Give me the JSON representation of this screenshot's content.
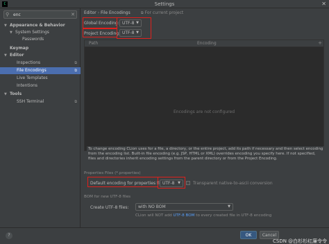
{
  "window": {
    "title": "Settings",
    "app_icon_text": "C"
  },
  "search": {
    "value": "enc"
  },
  "sidebar": {
    "items": [
      {
        "label": "Appearance & Behavior",
        "arrow": "▼"
      },
      {
        "label": "System Settings",
        "arrow": "▼"
      },
      {
        "label": "Passwords"
      },
      {
        "label": "Keymap"
      },
      {
        "label": "Editor",
        "arrow": "▼"
      },
      {
        "label": "Inspections",
        "project_icon": "⧉"
      },
      {
        "label": "File Encodings",
        "project_icon": "⧉"
      },
      {
        "label": "Live Templates"
      },
      {
        "label": "Intentions"
      },
      {
        "label": "Tools",
        "arrow": "▼"
      },
      {
        "label": "SSH Terminal",
        "project_icon": "⧉"
      }
    ]
  },
  "main": {
    "breadcrumb": {
      "parent": "Editor",
      "separator": "›",
      "current": "File Encodings"
    },
    "for_current_project": "For current project",
    "global_encoding": {
      "label": "Global Encoding:",
      "value": "UTF-8"
    },
    "project_encoding": {
      "label": "Project Encoding:",
      "value": "UTF-8"
    },
    "table": {
      "columns": [
        "Path",
        "Encoding"
      ],
      "empty_text": "Encodings are not configured"
    },
    "info_text": "To change encoding CLion uses for a file, a directory, or the entire project, add its path if necessary and then select encoding from the encoding list. Built-in file encoding (e.g. JSP, HTML or XML) overrides encoding you specify here. If not specified, files and directories inherit encoding settings from the parent directory or from the Project Encoding.",
    "properties": {
      "section_title": "Properties Files (*.properties)",
      "default_label": "Default encoding for properties files:",
      "default_value": "UTF-8",
      "transparent_label": "Transparent native-to-ascii conversion"
    },
    "bom": {
      "section_title": "BOM for new UTF-8 files",
      "create_label": "Create UTF-8 files:",
      "create_value": "with NO BOM",
      "note_before": "CLion will NOT add ",
      "note_link": "UTF-8 BOM",
      "note_after": " to every created file in UTF-8 encoding"
    }
  },
  "footer": {
    "help": "?",
    "ok_label": "OK",
    "cancel_label": "Cancel"
  },
  "watermark": "CSDN @白杉杉红廉令令",
  "colors": {
    "selection": "#4b6eaf",
    "highlight_box": "#e0201c",
    "primary_button": "#365880"
  }
}
